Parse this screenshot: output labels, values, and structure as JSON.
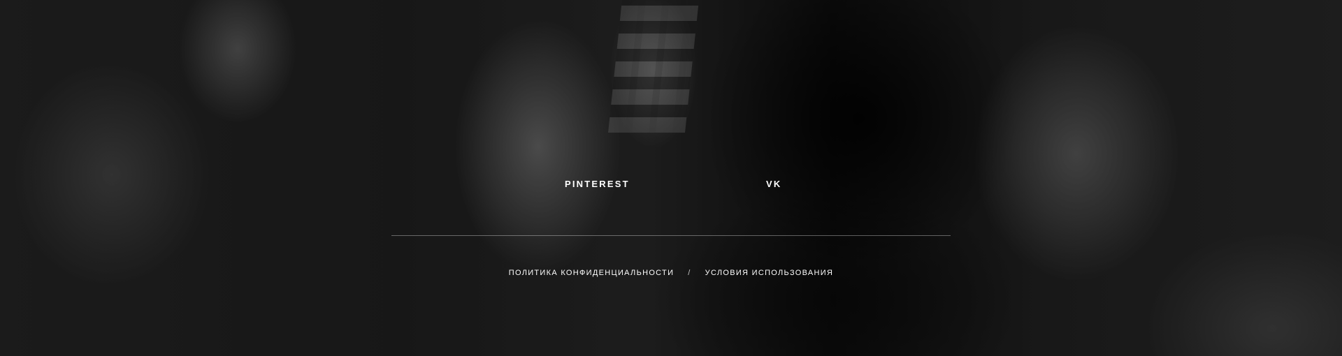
{
  "social": {
    "pinterest_label": "PINTEREST",
    "vk_label": "VK"
  },
  "legal": {
    "privacy_label": "ПОЛИТИКА КОНФИДЕНЦИАЛЬНОСТИ",
    "separator": "/",
    "terms_label": "УСЛОВИЯ ИСПОЛЬЗОВАНИЯ"
  },
  "colors": {
    "text": "#ffffff",
    "divider": "#8a8a8a",
    "background": "#1c1c1c"
  }
}
